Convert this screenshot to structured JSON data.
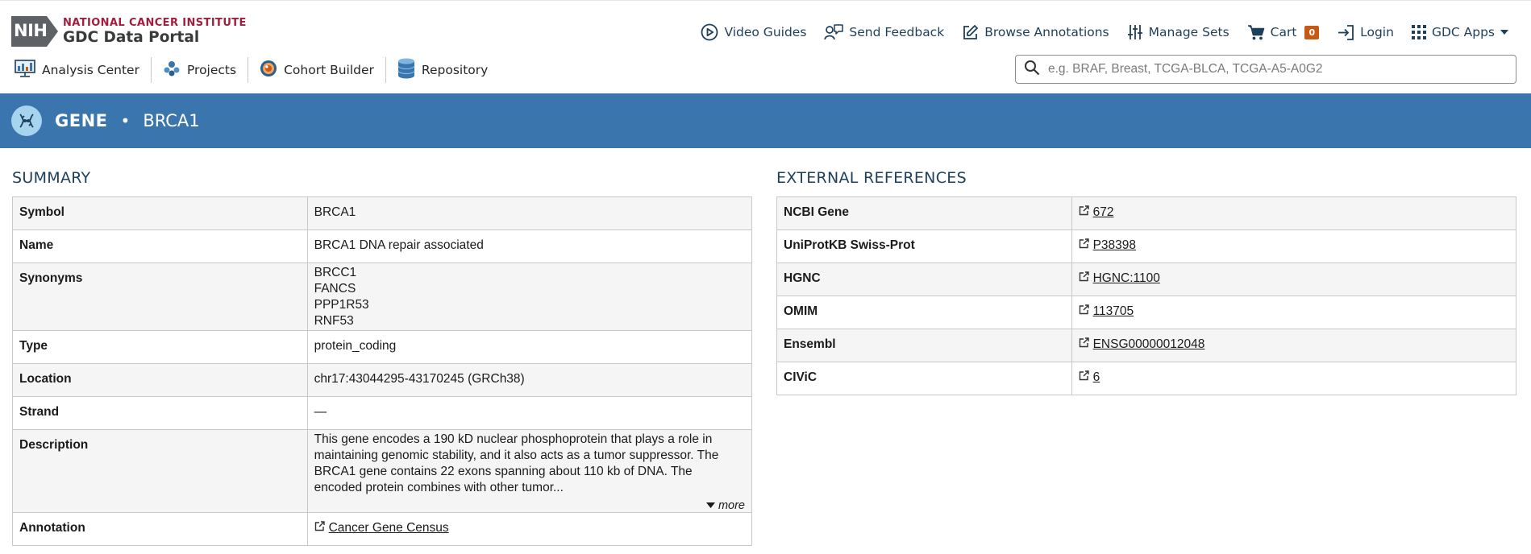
{
  "logo": {
    "badge": "NIH",
    "institute": "NATIONAL CANCER INSTITUTE",
    "portal": "GDC Data Portal"
  },
  "topnav": {
    "video_guides": "Video Guides",
    "send_feedback": "Send Feedback",
    "browse_annotations": "Browse Annotations",
    "manage_sets": "Manage Sets",
    "cart": "Cart",
    "cart_count": "0",
    "login": "Login",
    "gdc_apps": "GDC Apps"
  },
  "subnav": {
    "analysis_center": "Analysis Center",
    "projects": "Projects",
    "cohort_builder": "Cohort Builder",
    "repository": "Repository"
  },
  "search": {
    "placeholder": "e.g. BRAF, Breast, TCGA-BLCA, TCGA-A5-A0G2"
  },
  "entity": {
    "type": "GENE",
    "separator": "•",
    "name": "BRCA1"
  },
  "summary": {
    "title": "SUMMARY",
    "symbol": {
      "label": "Symbol",
      "value": "BRCA1"
    },
    "name": {
      "label": "Name",
      "value": "BRCA1 DNA repair associated"
    },
    "synonyms": {
      "label": "Synonyms",
      "values": [
        "BRCC1",
        "FANCS",
        "PPP1R53",
        "RNF53"
      ]
    },
    "type": {
      "label": "Type",
      "value": "protein_coding"
    },
    "location": {
      "label": "Location",
      "value": "chr17:43044295-43170245 (GRCh38)"
    },
    "strand": {
      "label": "Strand",
      "value": "—"
    },
    "description": {
      "label": "Description",
      "value": "This gene encodes a 190 kD nuclear phosphoprotein that plays a role in maintaining genomic stability, and it also acts as a tumor suppressor. The BRCA1 gene contains 22 exons spanning about 110 kb of DNA. The encoded protein combines with other tumor...",
      "more": "more"
    },
    "annotation": {
      "label": "Annotation",
      "value": "Cancer Gene Census"
    }
  },
  "external": {
    "title": "EXTERNAL REFERENCES",
    "ncbi": {
      "label": "NCBI Gene",
      "value": "672"
    },
    "uniprot": {
      "label": "UniProtKB Swiss-Prot",
      "value": "P38398"
    },
    "hgnc": {
      "label": "HGNC",
      "value": "HGNC:1100"
    },
    "omim": {
      "label": "OMIM",
      "value": "113705"
    },
    "ensembl": {
      "label": "Ensembl",
      "value": "ENSG00000012048"
    },
    "civic": {
      "label": "CIViC",
      "value": "6"
    }
  },
  "colors": {
    "brand_blue": "#3a75ad",
    "nav_text": "#1d3f5a",
    "nci_red": "#a11e3f",
    "cart_badge": "#c45a14"
  }
}
